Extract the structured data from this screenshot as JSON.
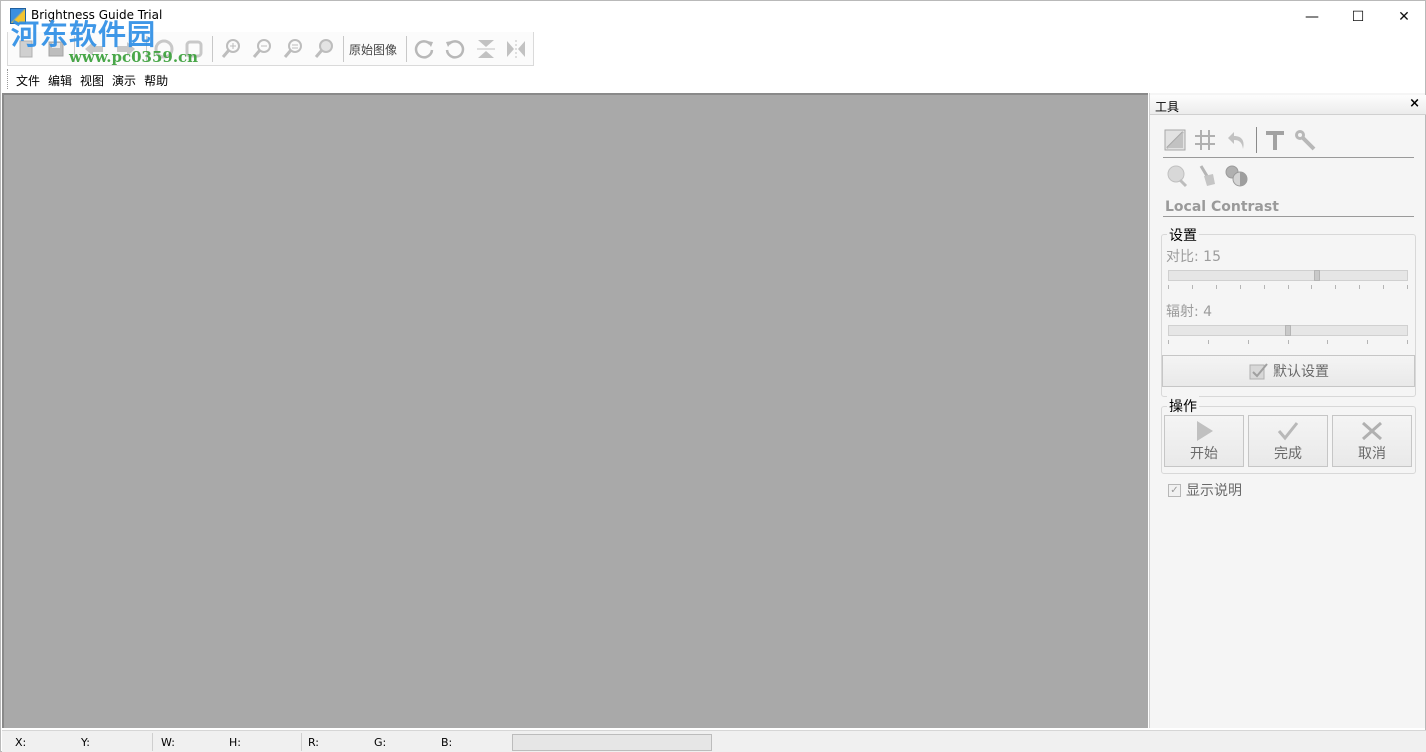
{
  "window": {
    "title": "Brightness Guide Trial",
    "controls": {
      "minimize": "—",
      "maximize": "☐",
      "close": "✕"
    }
  },
  "watermark": {
    "line1": "河东软件园",
    "line2": "www.pc0359.cn"
  },
  "toolbar": {
    "original_image_label": "原始图像",
    "buttons": [
      "new-icon",
      "open-icon",
      "save-icon",
      "back-icon",
      "forward-icon",
      "undo-icon",
      "redo-icon",
      "zoom-in-icon",
      "zoom-out-icon",
      "zoom-fit-icon",
      "zoom-actual-icon",
      "rotate-right-icon",
      "rotate-left-icon",
      "flip-vertical-icon",
      "flip-horizontal-icon"
    ]
  },
  "menu": {
    "items": [
      "文件",
      "编辑",
      "视图",
      "演示",
      "帮助"
    ]
  },
  "tools_panel": {
    "title": "工具",
    "close": "×",
    "mode_title": "Local Contrast",
    "settings": {
      "legend": "设置",
      "contrast": {
        "label": "对比: 15",
        "value": 15,
        "max": 24
      },
      "radius": {
        "label": "辐射: 4",
        "value": 4,
        "max": 8
      },
      "default_button": "默认设置"
    },
    "actions": {
      "legend": "操作",
      "start": "开始",
      "done": "完成",
      "cancel": "取消"
    },
    "show_help": {
      "label": "显示说明",
      "checked": true
    }
  },
  "statusbar": {
    "x": "X:",
    "y": "Y:",
    "w": "W:",
    "h": "H:",
    "r": "R:",
    "g": "G:",
    "b": "B:"
  },
  "colors": {
    "canvas": "#a9a9a9",
    "panel": "#f5f5f5",
    "watermark_blue": "#2f8fe6",
    "watermark_green": "#3aa03a"
  }
}
